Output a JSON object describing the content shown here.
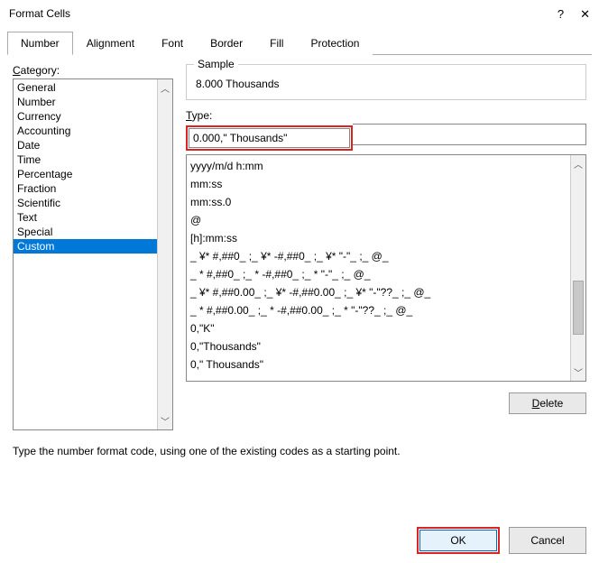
{
  "title": "Format Cells",
  "help_glyph": "?",
  "close_glyph": "✕",
  "tabs": [
    "Number",
    "Alignment",
    "Font",
    "Border",
    "Fill",
    "Protection"
  ],
  "active_tab": 0,
  "category_label": "Category:",
  "categories": [
    "General",
    "Number",
    "Currency",
    "Accounting",
    "Date",
    "Time",
    "Percentage",
    "Fraction",
    "Scientific",
    "Text",
    "Special",
    "Custom"
  ],
  "selected_category_index": 11,
  "sample_label": "Sample",
  "sample_value": "8.000 Thousands",
  "type_label": "Type:",
  "type_value": "0.000,\" Thousands\"",
  "formats": [
    "yyyy/m/d h:mm",
    "mm:ss",
    "mm:ss.0",
    "@",
    "[h]:mm:ss",
    "_ ¥* #,##0_ ;_ ¥* -#,##0_ ;_ ¥* \"-\"_ ;_ @_ ",
    "_ * #,##0_ ;_ * -#,##0_ ;_ * \"-\"_ ;_ @_ ",
    "_ ¥* #,##0.00_ ;_ ¥* -#,##0.00_ ;_ ¥* \"-\"??_ ;_ @_ ",
    "_ * #,##0.00_ ;_ * -#,##0.00_ ;_ * \"-\"??_ ;_ @_ ",
    "0,\"K\"",
    "0,\"Thousands\"",
    "0,\" Thousands\""
  ],
  "delete_label": "Delete",
  "hint_text": "Type the number format code, using one of the existing codes as a starting point.",
  "ok_label": "OK",
  "cancel_label": "Cancel"
}
